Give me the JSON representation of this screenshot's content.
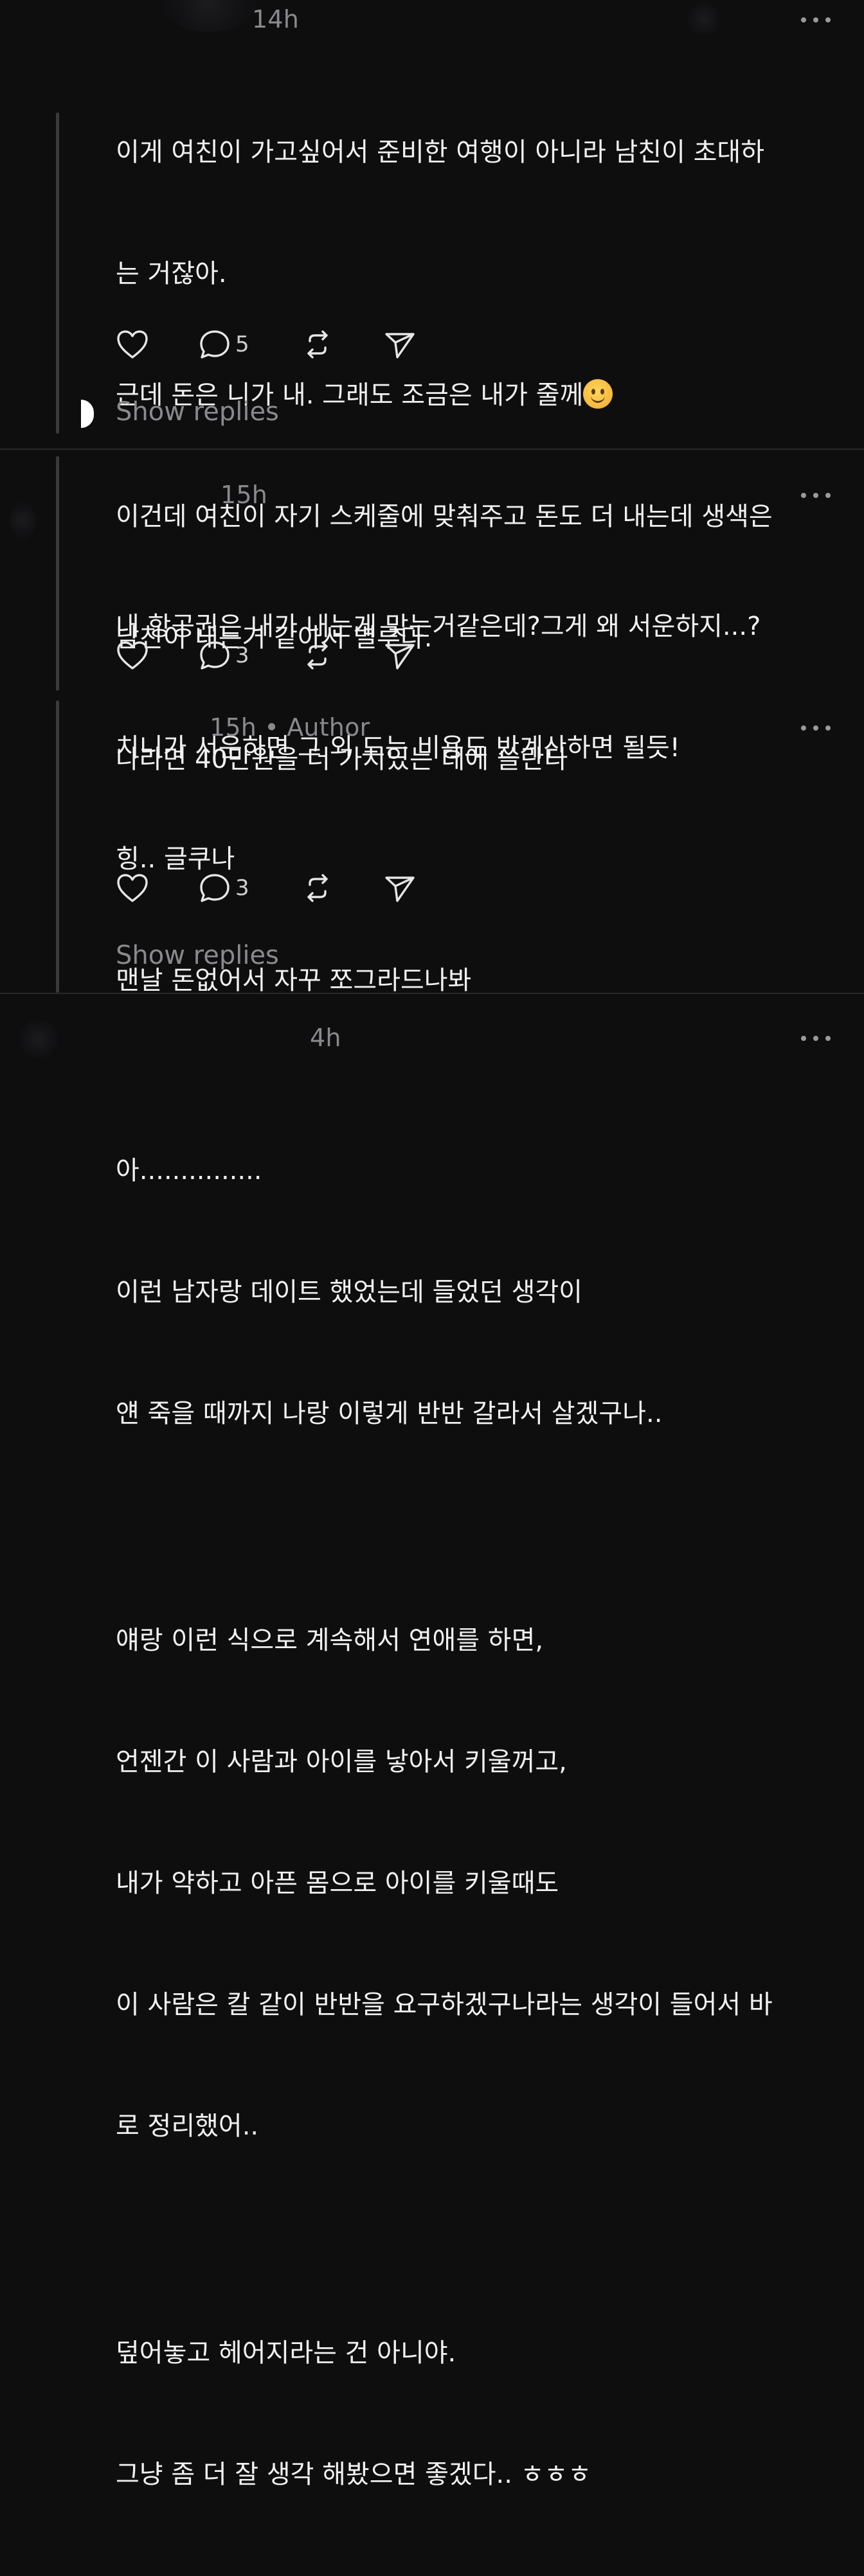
{
  "comments": [
    {
      "time": "14h",
      "author_tag": "",
      "text_lines": [
        "이게 여친이 가고싶어서 준비한 여행이 아니라 남친이 초대하",
        "는 거잖아.",
        "근데 돈은 니가 내. 그래도 조금은 내가 줄께",
        "이건데 여친이 자기 스케줄에 맞춰주고 돈도 더 내는데 생색은",
        "남친이 내는거 같아서 별루다.",
        "나라면 40만원을 더 가치있는 데에 쓸란다"
      ],
      "emoji": "slightly-smiling-face",
      "reply_count": "5",
      "show_replies": "Show replies"
    },
    {
      "time": "15h",
      "text_lines": [
        "내 항공권은 내가 내는게 맞는거같은데?그게 왜 서운하지...?",
        "치니가 서운하면 그 외 드는 비용도 반계산하면 될듯!"
      ],
      "reply_count": "3"
    },
    {
      "time": "15h",
      "author_tag": "• Author",
      "text_lines": [
        "힝.. 글쿠나",
        "맨날 돈없어서 자꾸 쪼그라드나봐"
      ],
      "reply_count": "3",
      "show_replies": "Show replies"
    },
    {
      "time": "4h",
      "text_lines": [
        "아...............",
        "이런 남자랑 데이트 했었는데 들었던 생각이",
        "얜 죽을 때까지 나랑 이렇게 반반 갈라서 살겠구나..",
        "",
        "얘랑 이런 식으로 계속해서 연애를 하면,",
        "언젠간 이 사람과 아이를 낳아서 키울꺼고,",
        "내가 약하고 아픈 몸으로 아이를 키울때도",
        "이 사람은 칼 같이 반반을 요구하겠구나라는 생각이 들어서 바",
        "로 정리했어..",
        "",
        "덮어놓고 헤어지라는 건 아니야.",
        "그냥 좀 더 잘 생각 해봤으면 좋겠다.. ㅎㅎㅎ"
      ]
    }
  ],
  "icons": {
    "like": "heart-icon",
    "reply": "comment-bubble-icon",
    "repost": "repost-icon",
    "share": "send-icon",
    "more": "more-dots-icon"
  },
  "colors": {
    "background": "#0e0e0f",
    "text": "#f1f1f1",
    "muted": "#8a8a8e",
    "divider": "#2a2a2c",
    "thread_line": "#3a3a3c"
  }
}
